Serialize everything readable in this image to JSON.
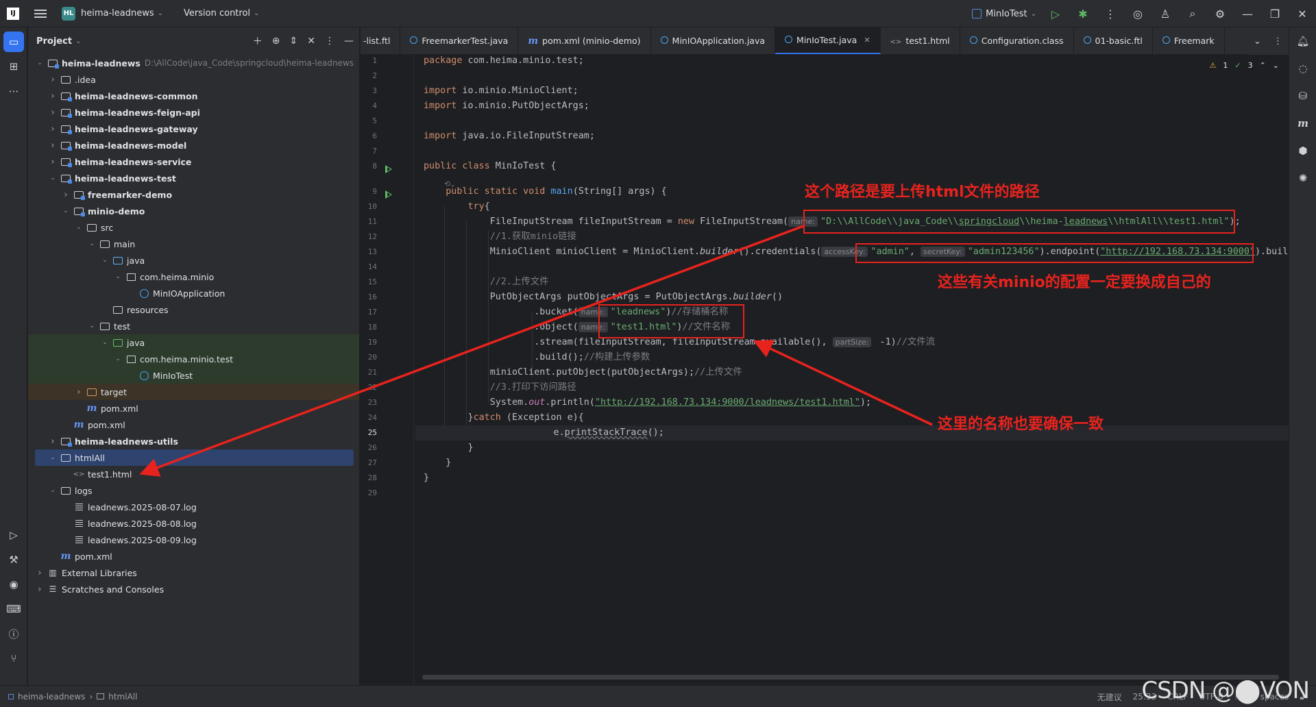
{
  "titlebar": {
    "app_logo": "IJ",
    "project_badge": "HL",
    "project_name": "heima-leadnews",
    "vcs": "Version control",
    "run_config": "MinIoTest"
  },
  "project_panel": {
    "title": "Project",
    "tree": [
      {
        "label": "heima-leadnews",
        "hint": "D:\\AllCode\\java_Code\\springcloud\\heima-leadnews",
        "indent": 0,
        "arrow": "open",
        "icon": "folder-mod",
        "bold": true
      },
      {
        "label": ".idea",
        "indent": 1,
        "arrow": "closed",
        "icon": "folder"
      },
      {
        "label": "heima-leadnews-common",
        "indent": 1,
        "arrow": "closed",
        "icon": "folder-mod",
        "bold": true
      },
      {
        "label": "heima-leadnews-feign-api",
        "indent": 1,
        "arrow": "closed",
        "icon": "folder-mod",
        "bold": true
      },
      {
        "label": "heima-leadnews-gateway",
        "indent": 1,
        "arrow": "closed",
        "icon": "folder-mod",
        "bold": true
      },
      {
        "label": "heima-leadnews-model",
        "indent": 1,
        "arrow": "closed",
        "icon": "folder-mod",
        "bold": true
      },
      {
        "label": "heima-leadnews-service",
        "indent": 1,
        "arrow": "closed",
        "icon": "folder-mod",
        "bold": true
      },
      {
        "label": "heima-leadnews-test",
        "indent": 1,
        "arrow": "open",
        "icon": "folder-mod",
        "bold": true
      },
      {
        "label": "freemarker-demo",
        "indent": 2,
        "arrow": "closed",
        "icon": "folder-mod",
        "bold": true
      },
      {
        "label": "minio-demo",
        "indent": 2,
        "arrow": "open",
        "icon": "folder-mod",
        "bold": true
      },
      {
        "label": "src",
        "indent": 3,
        "arrow": "open",
        "icon": "folder"
      },
      {
        "label": "main",
        "indent": 4,
        "arrow": "open",
        "icon": "folder"
      },
      {
        "label": "java",
        "indent": 5,
        "arrow": "open",
        "icon": "folder-src"
      },
      {
        "label": "com.heima.minio",
        "indent": 6,
        "arrow": "open",
        "icon": "package"
      },
      {
        "label": "MinIOApplication",
        "indent": 7,
        "arrow": "none",
        "icon": "class"
      },
      {
        "label": "resources",
        "indent": 5,
        "arrow": "none",
        "icon": "folder"
      },
      {
        "label": "test",
        "indent": 4,
        "arrow": "open",
        "icon": "folder"
      },
      {
        "label": "java",
        "indent": 5,
        "arrow": "open",
        "icon": "folder-test",
        "hl": "test"
      },
      {
        "label": "com.heima.minio.test",
        "indent": 6,
        "arrow": "open",
        "icon": "package",
        "hl": "test"
      },
      {
        "label": "MinIoTest",
        "indent": 7,
        "arrow": "none",
        "icon": "class",
        "hl": "test"
      },
      {
        "label": "target",
        "indent": 3,
        "arrow": "closed",
        "icon": "folder-exc",
        "hl": "target"
      },
      {
        "label": "pom.xml",
        "indent": 3,
        "arrow": "none",
        "icon": "maven"
      },
      {
        "label": "pom.xml",
        "indent": 2,
        "arrow": "none",
        "icon": "maven"
      },
      {
        "label": "heima-leadnews-utils",
        "indent": 1,
        "arrow": "closed",
        "icon": "folder-mod",
        "bold": true
      },
      {
        "label": "htmlAll",
        "indent": 1,
        "arrow": "open",
        "icon": "folder",
        "hl": "selected"
      },
      {
        "label": "test1.html",
        "indent": 2,
        "arrow": "none",
        "icon": "html"
      },
      {
        "label": "logs",
        "indent": 1,
        "arrow": "open",
        "icon": "folder"
      },
      {
        "label": "leadnews.2025-08-07.log",
        "indent": 2,
        "arrow": "none",
        "icon": "log"
      },
      {
        "label": "leadnews.2025-08-08.log",
        "indent": 2,
        "arrow": "none",
        "icon": "log"
      },
      {
        "label": "leadnews.2025-08-09.log",
        "indent": 2,
        "arrow": "none",
        "icon": "log"
      },
      {
        "label": "pom.xml",
        "indent": 1,
        "arrow": "none",
        "icon": "maven"
      },
      {
        "label": "External Libraries",
        "indent": 0,
        "arrow": "closed",
        "icon": "lib"
      },
      {
        "label": "Scratches and Consoles",
        "indent": 0,
        "arrow": "closed",
        "icon": "scratch"
      }
    ]
  },
  "tabs": [
    {
      "label": "-list.ftl",
      "icon": ""
    },
    {
      "label": "FreemarkerTest.java",
      "icon": "class"
    },
    {
      "label": "pom.xml (minio-demo)",
      "icon": "maven"
    },
    {
      "label": "MinIOApplication.java",
      "icon": "class"
    },
    {
      "label": "MinIoTest.java",
      "icon": "class",
      "active": true
    },
    {
      "label": "test1.html",
      "icon": "html"
    },
    {
      "label": "Configuration.class",
      "icon": "class"
    },
    {
      "label": "01-basic.ftl",
      "icon": "class"
    },
    {
      "label": "Freemark",
      "icon": "class"
    }
  ],
  "inspections": {
    "warnings": "1",
    "ok": "3"
  },
  "code": {
    "l1_pkg": "package",
    "l1_name": " com.heima.minio.test;",
    "l3_imp": "import",
    "l3_name": " io.minio.MinioClient;",
    "l4_imp": "import",
    "l4_name": " io.minio.PutObjectArgs;",
    "l6_imp": "import",
    "l6_name": " java.io.FileInputStream;",
    "l8_public": "public",
    "l8_class": " class",
    "l8_name": " MinIoTest {",
    "l9_mods": "public static void",
    "l9_main": " main",
    "l9_rest": "(String[] args) {",
    "l10_try": "try",
    "l10_rest": "{",
    "l11_a": "FileInputStream fileInputStream = ",
    "l11_new": "new",
    "l11_b": " FileInputStream(",
    "l11_hint": "name:",
    "l11_str_a": "\"D:\\\\AllCode\\\\java_Code\\\\",
    "l11_str_u1": "springcloud",
    "l11_str_b": "\\\\heima-",
    "l11_str_u2": "leadnews",
    "l11_str_c": "\\\\htmlAll\\\\test1.html\"",
    "l11_end": ");",
    "l12": "//1.获取minio链接",
    "l13_a": "MinioClient minioClient = MinioClient.",
    "l13_builder": "builder",
    "l13_b": "().credentials(",
    "l13_hint1": "accessKey:",
    "l13_s1": "\"admin\"",
    "l13_c": ", ",
    "l13_hint2": "secretKey:",
    "l13_s2": "\"admin123456\"",
    "l13_d": ").endpoint(",
    "l13_url": "\"http://192.168.73.134:9000\"",
    "l13_e": ").build",
    "l15": "//2.上传文件",
    "l16_a": "PutObjectArgs putObjectArgs = PutObjectArgs.",
    "l16_builder": "builder",
    "l16_b": "()",
    "l17_a": ".bucket(",
    "l17_hint": "name:",
    "l17_s": "\"leadnews\"",
    "l17_b": ")",
    "l17_c": "//存储桶名称",
    "l18_a": ".object(",
    "l18_hint": "name:",
    "l18_s": "\"test1.html\"",
    "l18_b": ")",
    "l18_c": "//文件名称",
    "l19_a": ".stream(fileInputStream, fileInputStream.available(), ",
    "l19_hint": "partSize:",
    "l19_b": " -1)",
    "l19_c": "//文件流",
    "l20_a": ".build();",
    "l20_c": "//构建上传参数",
    "l21_a": "minioClient.putObject(putObjectArgs);",
    "l21_c": "//上传文件",
    "l22": "//3.打印下访问路径",
    "l23_a": "System.",
    "l23_out": "out",
    "l23_b": ".println(",
    "l23_url": "\"http://192.168.73.134:9000/leadnews/test1.html\"",
    "l23_c": ");",
    "l24_a": "}",
    "l24_catch": "catch",
    "l24_b": " (Exception e){",
    "l25_a": "e.",
    "l25_fn": "printStackTrace",
    "l25_b": "();",
    "l26": "}",
    "l27": "}",
    "l28": "}"
  },
  "annotations": {
    "a1": "这个路径是要上传html文件的路径",
    "a2": "这些有关minio的配置一定要换成自己的",
    "a3": "这里的名称也要确保一致",
    "color": "#e8231e"
  },
  "statusbar": {
    "crumb1": "heima-leadnews",
    "crumb2": "htmlAll",
    "advice": "无建议",
    "position": "25:33",
    "line_sep": "CRLF",
    "encoding": "UTF-8",
    "indent": "4 spaces"
  },
  "watermark": "CSDN @⬤VON"
}
